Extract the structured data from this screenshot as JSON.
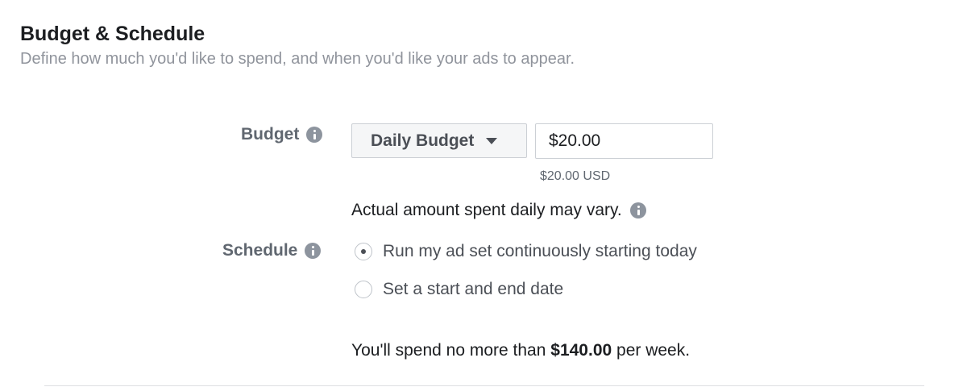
{
  "section": {
    "title": "Budget & Schedule",
    "subtitle": "Define how much you'd like to spend, and when you'd like your ads to appear."
  },
  "budget": {
    "label": "Budget",
    "type_selected": "Daily Budget",
    "amount_value": "$20.00",
    "amount_help": "$20.00 USD",
    "vary_note": "Actual amount spent daily may vary."
  },
  "schedule": {
    "label": "Schedule",
    "options": [
      {
        "label": "Run my ad set continuously starting today",
        "selected": true
      },
      {
        "label": "Set a start and end date",
        "selected": false
      }
    ]
  },
  "summary": {
    "prefix": "You'll spend no more than",
    "amount": "$140.00",
    "suffix": "per week."
  },
  "colors": {
    "title": "#1c1e21",
    "subtitle": "#90949c",
    "label": "#606770",
    "info_icon": "#8d949e",
    "border": "#ccd0d5"
  }
}
